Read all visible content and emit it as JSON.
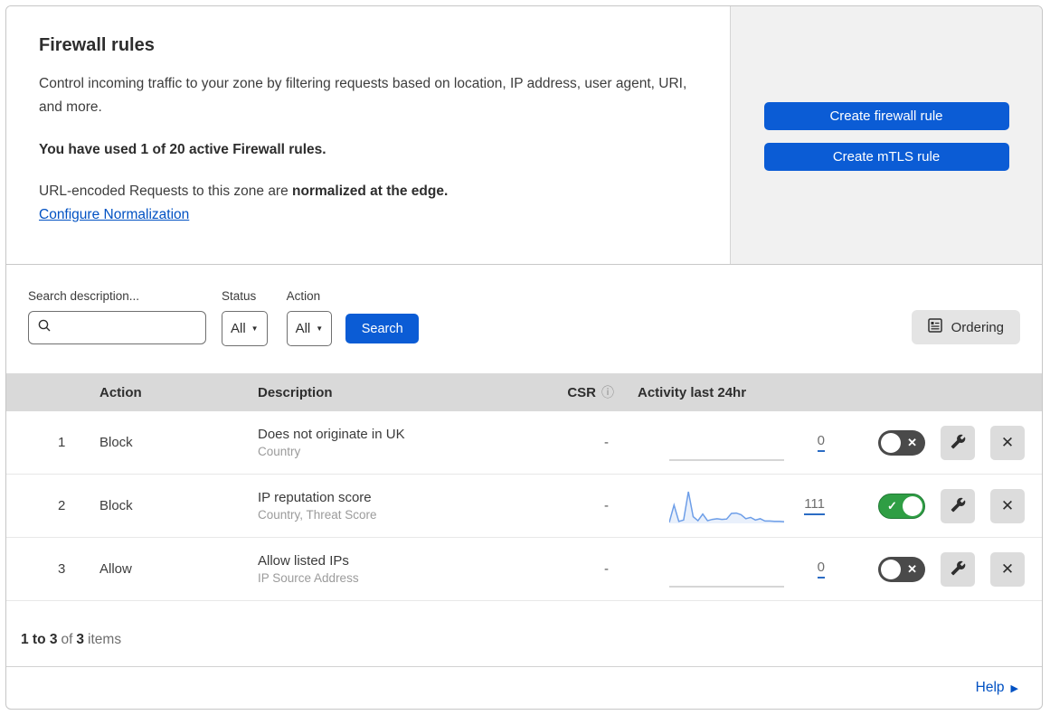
{
  "header": {
    "title": "Firewall rules",
    "description": "Control incoming traffic to your zone by filtering requests based on location, IP address, user agent, URI, and more.",
    "usage_bold": "You have used 1 of 20 active Firewall rules.",
    "normalization_prefix": "URL-encoded Requests to this zone are ",
    "normalization_bold": "normalized at the edge.",
    "normalization_link": "Configure Normalization"
  },
  "actions_panel": {
    "create_firewall_label": "Create firewall rule",
    "create_mtls_label": "Create mTLS rule"
  },
  "filters": {
    "search_label": "Search description...",
    "search_value": "",
    "status_label": "Status",
    "status_value": "All",
    "action_label": "Action",
    "action_value": "All",
    "search_button": "Search",
    "ordering_button": "Ordering"
  },
  "table": {
    "columns": {
      "action": "Action",
      "description": "Description",
      "csr": "CSR",
      "activity": "Activity last 24hr"
    },
    "rows": [
      {
        "priority": "1",
        "action": "Block",
        "description": "Does not originate in UK",
        "fields": "Country",
        "csr": "-",
        "activity_count": "0",
        "activity_values": [
          0,
          0,
          0,
          0,
          0,
          0,
          0,
          0,
          0,
          0,
          0,
          0
        ],
        "enabled": false
      },
      {
        "priority": "2",
        "action": "Block",
        "description": "IP reputation score",
        "fields": "Country, Threat Score",
        "csr": "-",
        "activity_count": "111",
        "activity_values": [
          3,
          55,
          6,
          10,
          95,
          20,
          8,
          28,
          8,
          12,
          14,
          12,
          13,
          30,
          31,
          26,
          14,
          18,
          10,
          14,
          7,
          7,
          6,
          6,
          5
        ],
        "enabled": true
      },
      {
        "priority": "3",
        "action": "Allow",
        "description": "Allow listed IPs",
        "fields": "IP Source Address",
        "csr": "-",
        "activity_count": "0",
        "activity_values": [
          0,
          0,
          0,
          0,
          0,
          0,
          0,
          0,
          0,
          0,
          0,
          0
        ],
        "enabled": false
      }
    ],
    "footer": {
      "range_bold": "1 to 3",
      "of_text": "of",
      "total_bold": "3",
      "items_text": "items"
    }
  },
  "help": {
    "label": "Help"
  },
  "icons": {
    "caret_glyph": "▼",
    "close_glyph": "✕",
    "check_glyph": "✓",
    "info_glyph": "ⓘ",
    "help_arrow_glyph": "▶"
  },
  "colors": {
    "accent_blue": "#0b5cd5",
    "link_blue": "#0051c3",
    "toggle_on_green": "#2f9e44",
    "toggle_off_gray": "#4a4a4a",
    "sparkline_blue": "#6d9ee8",
    "sparkline_fill": "#e9f0fb",
    "header_gray": "#d9d9d9"
  }
}
